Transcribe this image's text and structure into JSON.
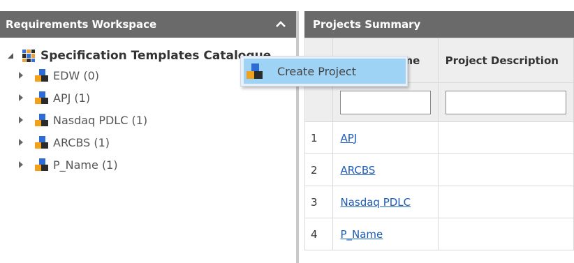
{
  "left_panel": {
    "title": "Requirements Workspace",
    "collapse_icon": "chevron-up-icon",
    "tree": {
      "root_label": "Specification Templates Catalogue",
      "items": [
        {
          "label": "EDW (0)"
        },
        {
          "label": "APJ (1)"
        },
        {
          "label": "Nasdaq PDLC (1)"
        },
        {
          "label": "ARCBS (1)"
        },
        {
          "label": "P_Name (1)"
        }
      ]
    }
  },
  "context_menu": {
    "items": [
      {
        "label": "Create Project",
        "icon": "project-icon"
      }
    ]
  },
  "right_panel": {
    "title": "Projects Summary",
    "columns": [
      "#",
      "Project Name",
      "Project Description"
    ],
    "rows": [
      {
        "no": "1",
        "name": "APJ",
        "description": ""
      },
      {
        "no": "2",
        "name": "ARCBS",
        "description": ""
      },
      {
        "no": "3",
        "name": "Nasdaq PDLC",
        "description": ""
      },
      {
        "no": "4",
        "name": "P_Name",
        "description": ""
      }
    ]
  },
  "colors": {
    "header_bg": "#6a6a6a",
    "menu_highlight": "#9fd3f5",
    "link": "#1b5cb8",
    "icon_blue": "#2d6bd6",
    "icon_orange": "#f2a21a",
    "icon_dark": "#2b2b2b"
  }
}
